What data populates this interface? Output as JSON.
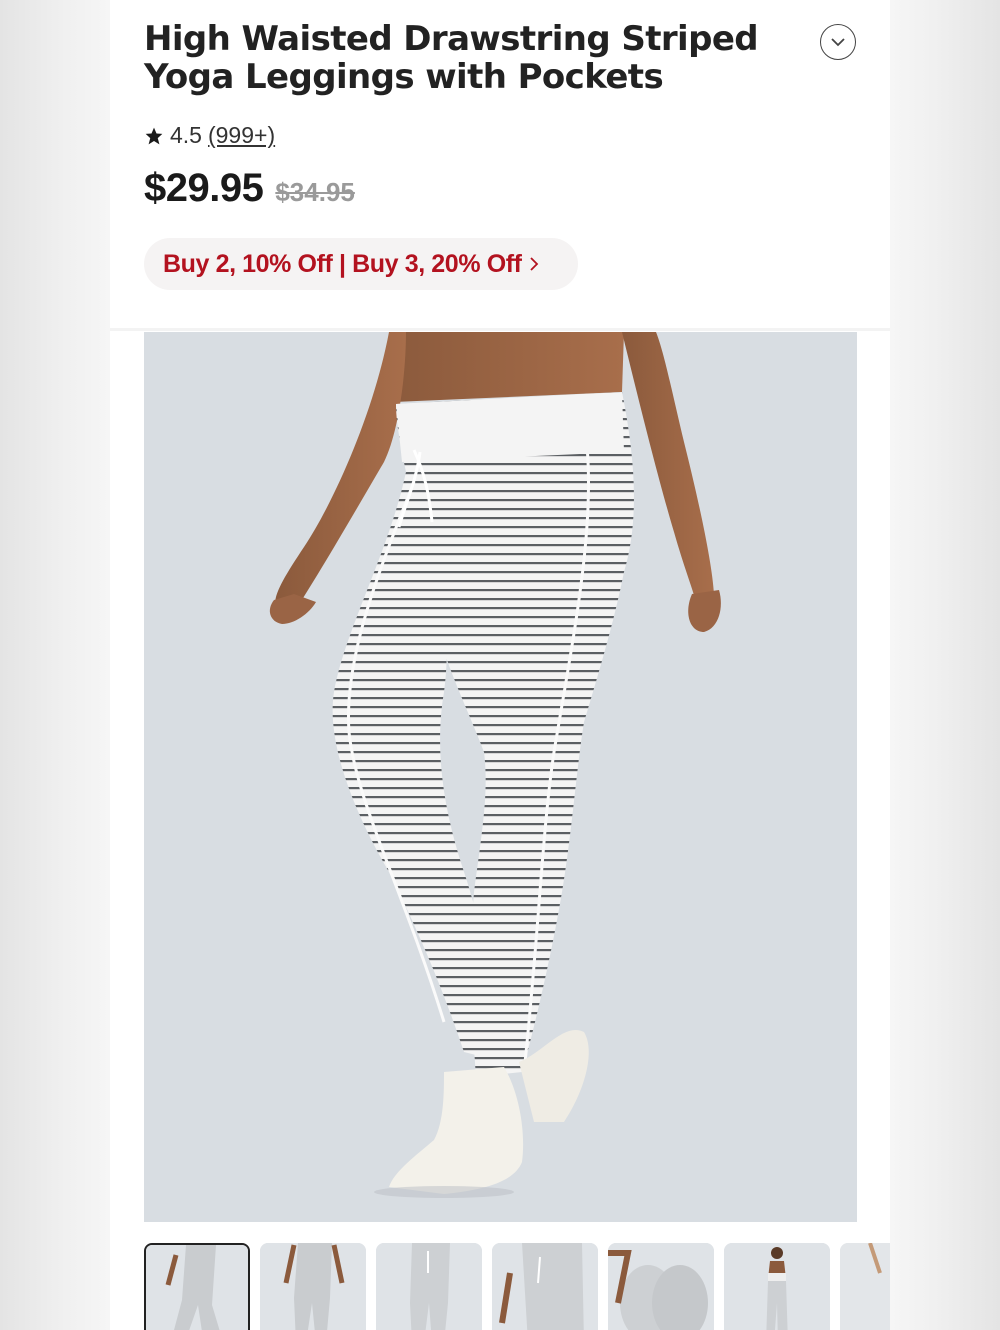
{
  "product": {
    "title": "High Waisted Drawstring Striped Yoga Leggings with Pockets",
    "rating": "4.5",
    "review_count": "(999+)",
    "price": "$29.95",
    "original_price": "$34.95",
    "promo_text": "Buy 2, 10% Off | Buy 3, 20% Off"
  },
  "icons": {
    "collapse": "chevron-down-icon",
    "star": "star-icon",
    "promo_arrow": "chevron-right-icon"
  },
  "colors": {
    "promo_text": "#b3121f",
    "promo_bg": "#f5f3f3",
    "hero_bg": "#d8dde2"
  },
  "gallery": {
    "active_index": 0,
    "thumbnail_count": 7
  }
}
